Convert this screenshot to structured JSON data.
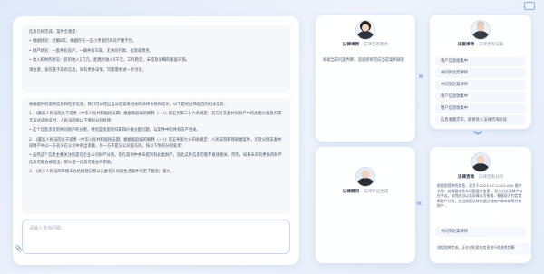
{
  "chat": {
    "message1": [
      "信息已经完成，案件全貌是：",
      "• 婚姻状况：结婚8年，婚姻存在一些小矛盾但尚有严重不合。",
      "• 财产状况：一套共有房产，一辆共有车辆，无共同存款、投资或债务。",
      "• 收入和财务状况：您的收入1万元，配偶月收入5千元，工作稳定，未提及详细的家庭开销。",
      "请注意，该仅基于现有信息，如有更多详情，可能需要进一步讨论。"
    ],
    "message2_intro": "根据提供的案例信息和检索信息，我们可以得出当与您案情相关的法律条款和结论，以下是经过筛选后的相关信息：",
    "message2_items": [
      "1. 《最高人民法院关于适用〈中华人民共和国民法典〉婚姻家庭编的解释（一）》第五条第二十六条规定：双方对夫妻共同财产中的房屋价值及归属无法达成协议时，人民法院按以下情形分别处理：",
      "• 这个信息涉及到共同财产的分割，特别是房屋的归属和价值分配问题，与案件中的共有房产相关。",
      "2. 《最高人民法院关于适用〈中华人民共和国民法典〉婚姻家庭编的解释（一）》第五条第七十四条规定：人民法院审理离婚案件，涉及分割夫妻共同财产中以一方名义在公司中的出资额，另一方不是该公司股东的，按以下情形分别处理：",
      "• 虽然这个信息主要关注的是在企业公司财产分割，但在案例中并未提到有此类财产，因此这条信息可能不直接相关。然而，如果未来有更多的财产信息可能会被提出，那么这一信息可能会有帮助。",
      "3. 《关于人民法院审理未办结婚登记而以夫妻名义同居生活案件的若干意见》第九..."
    ],
    "input_placeholder": "请输入咨询问题...",
    "send_label": "发送"
  },
  "agents": [
    {
      "role": "法律律师",
      "desc": "法律咨询服务",
      "body": "根据当前问题判断，流程即将完成当前案例调查",
      "items": []
    },
    {
      "role": "法案律师",
      "desc": "法律咨询法案",
      "body": "",
      "items": [
        "用户信息收集中",
        "共同到达案律师",
        "共同到达案律师",
        "用户信息收集中",
        "用户信息收集中",
        "信息收集完毕，即将进入法律咨询阶段"
      ]
    },
    {
      "role": "法律顾问",
      "desc": "法律建议生成",
      "body": "",
      "items": []
    },
    {
      "role": "法律咨询",
      "desc": "法律咨询分析",
      "body": "根据您提供的信息，双方于2023-07-2-012-002 案件名称：若婚姻关系有问题要求变更... 双方对夫妻财产存在争议，法院应当以实际情况为依据，根据双方约定判断财产分割，应当按照法律依据分割房产和车辆等共有财产...",
      "items": [
        "共同到达案律师",
        "法律顾问在线"
      ],
      "footer": "流程即将完成，正在对检索的信息进行相关性判断"
    }
  ],
  "colors": {
    "accent": "#3d7be0",
    "background": "#e3ecf9"
  }
}
